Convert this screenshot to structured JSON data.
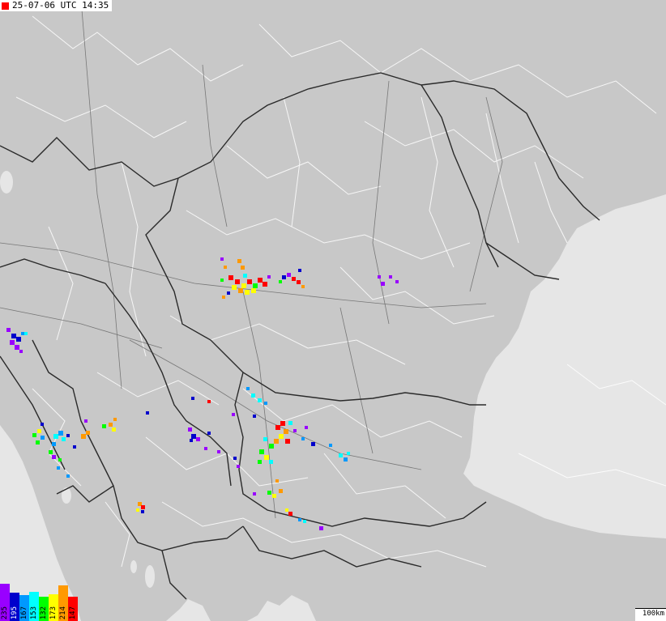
{
  "header": {
    "timestamp": "25-07-06 UTC 14:35",
    "marker_color": "#ff0000"
  },
  "legend": {
    "items": [
      {
        "label": "235",
        "color": "#9900ff"
      },
      {
        "label": "195",
        "color": "#0000cc"
      },
      {
        "label": "167",
        "color": "#0099ff"
      },
      {
        "label": "153",
        "color": "#00ffff"
      },
      {
        "label": "132",
        "color": "#00ff00"
      },
      {
        "label": "173",
        "color": "#ffff00"
      },
      {
        "label": "214",
        "color": "#ff9900"
      },
      {
        "label": "147",
        "color": "#ff0000"
      }
    ]
  },
  "scale": {
    "label": "100km"
  },
  "colors": {
    "land": "#c8c8c8",
    "sea": "#e6e6e6",
    "country_border": "#2a2a2a",
    "region_border": "#ffffff",
    "roads": "#555555"
  }
}
